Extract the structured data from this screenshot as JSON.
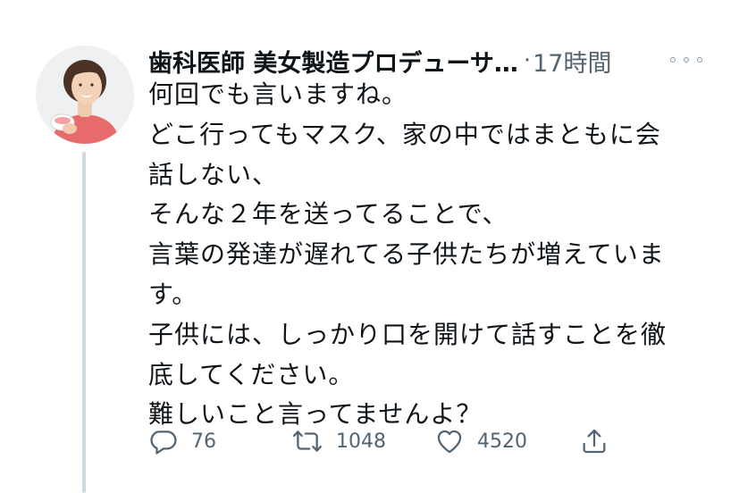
{
  "tweet": {
    "author_name": "歯科医師 美女製造プロデューサ…",
    "separator": "·",
    "time": "17時間",
    "more_icon": "more-horizontal-icon",
    "avatar_icon": "profile-photo-avatar",
    "body_lines": [
      "何回でも言いますね。",
      "どこ行ってもマスク、家の中ではまともに会",
      "話しない、",
      "そんな２年を送ってることで、",
      "言葉の発達が遅れてる子供たちが増えていま",
      "す。",
      "子供には、しっかり口を開けて話すことを徹",
      "底してください。",
      "難しいこと言ってませんよ？"
    ],
    "actions": {
      "reply": {
        "icon": "reply-icon",
        "count": "76"
      },
      "retweet": {
        "icon": "retweet-icon",
        "count": "1048"
      },
      "like": {
        "icon": "heart-icon",
        "count": "4520"
      },
      "share": {
        "icon": "share-icon"
      }
    },
    "colors": {
      "text": "#0f1419",
      "secondary": "#536471",
      "thread_line": "#cfd9de",
      "background": "#ffffff"
    }
  }
}
